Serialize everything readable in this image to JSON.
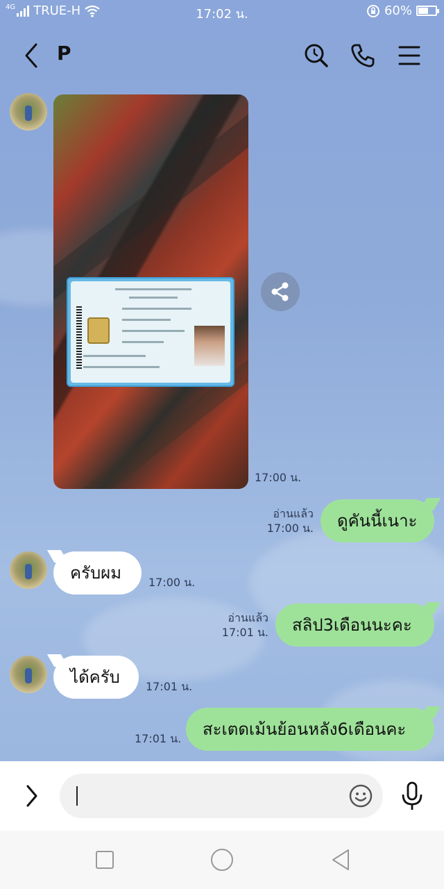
{
  "status_bar": {
    "network": "4G",
    "carrier": "TRUE-H",
    "time": "17:02 น.",
    "battery_percent": "60%",
    "battery_level": 0.6,
    "icons": [
      "signal-icon",
      "wifi-icon",
      "rotation-lock-icon",
      "battery-icon"
    ]
  },
  "header": {
    "contact_name": "P",
    "icons": [
      "back-arrow-icon",
      "search-icon",
      "phone-icon",
      "menu-icon"
    ]
  },
  "messages": [
    {
      "type": "image",
      "direction": "in",
      "time": "17:00 น."
    },
    {
      "type": "text",
      "direction": "out",
      "text": "ดูคันนี้เนาะ",
      "read": "อ่านแล้ว",
      "time": "17:00 น."
    },
    {
      "type": "text",
      "direction": "in",
      "text": "ครับผม",
      "time": "17:00 น."
    },
    {
      "type": "text",
      "direction": "out",
      "text": "สลิป3เดือนนะคะ",
      "read": "อ่านแล้ว",
      "time": "17:01 น."
    },
    {
      "type": "text",
      "direction": "in",
      "text": "ได้ครับ",
      "time": "17:01 น."
    },
    {
      "type": "text",
      "direction": "out",
      "text": "สะเตดเม้นย้อนหลัง6เดือนคะ",
      "time": "17:01 น."
    }
  ],
  "input_bar": {
    "value": "",
    "placeholder": "",
    "icons": [
      "expand-chevron-icon",
      "emoji-icon",
      "microphone-icon"
    ]
  },
  "nav_bar": {
    "icons": [
      "recent-apps-icon",
      "home-icon",
      "back-triangle-icon"
    ]
  },
  "colors": {
    "chat_background": "#8ea9d8",
    "outgoing_bubble": "#9ee29a",
    "incoming_bubble": "#ffffff"
  }
}
